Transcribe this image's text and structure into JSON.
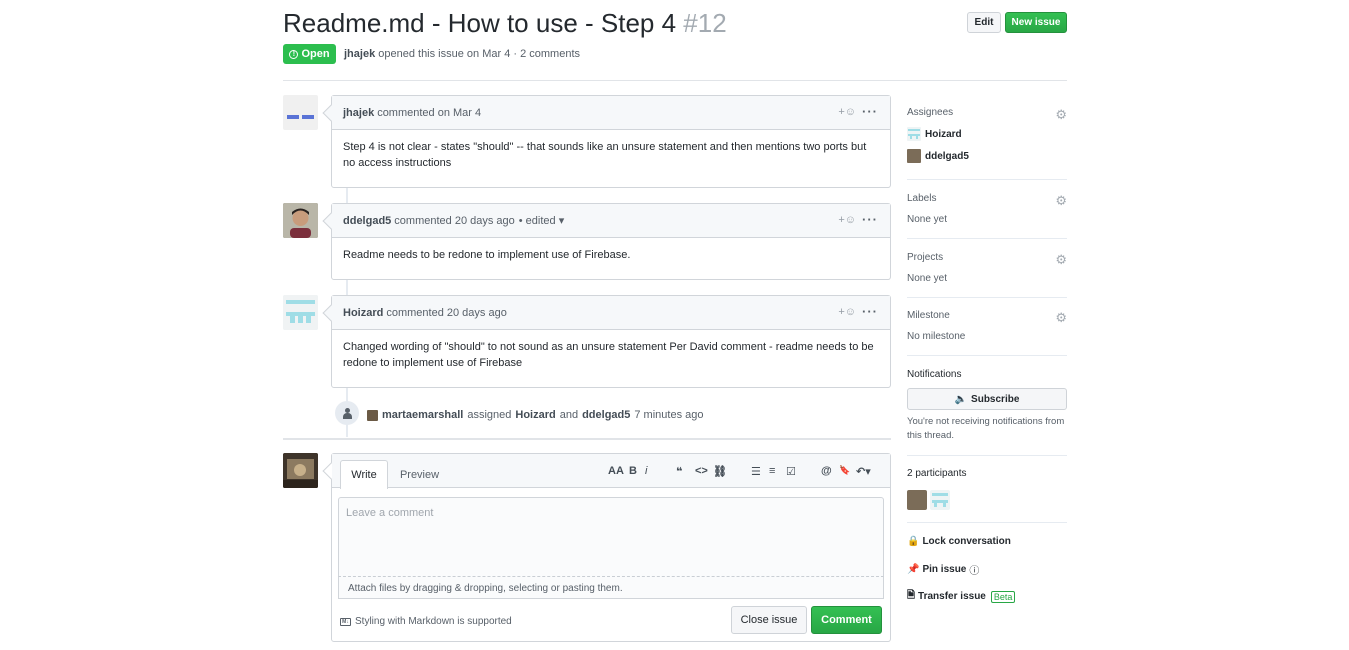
{
  "issue": {
    "title": "Readme.md - How to use - Step 4",
    "number": "#12",
    "state": "Open",
    "author": "jhajek",
    "meta_rest": "opened this issue on Mar 4 · 2 comments"
  },
  "header_buttons": {
    "edit": "Edit",
    "new_issue": "New issue"
  },
  "comments": [
    {
      "author": "jhajek",
      "action": "commented on Mar 4",
      "edited": "",
      "body": "Step 4 is not clear - states \"should\" -- that sounds like an unsure statement and then mentions two ports but no access instructions"
    },
    {
      "author": "ddelgad5",
      "action": "commented 20 days ago",
      "edited": "• edited ▾",
      "body": "Readme needs to be redone to implement use of Firebase."
    },
    {
      "author": "Hoizard",
      "action": "commented 20 days ago",
      "edited": "",
      "body": "Changed wording of \"should\" to not sound as an unsure statement Per David comment - readme needs to be redone to implement use of Firebase"
    }
  ],
  "comment_actions": {
    "react": "+☺",
    "menu": "···"
  },
  "event": {
    "actor": "martaemarshall",
    "verb": "assigned",
    "user1": "Hoizard",
    "conj": "and",
    "user2": "ddelgad5",
    "time": "7 minutes ago"
  },
  "new_comment": {
    "tab_write": "Write",
    "tab_preview": "Preview",
    "placeholder": "Leave a comment",
    "attach_text": "Attach files by dragging & dropping, selecting or pasting them.",
    "markdown_note": "Styling with Markdown is supported",
    "close_button": "Close issue",
    "comment_button": "Comment",
    "toolbar": {
      "header": "AA",
      "bold": "B",
      "italic": "i",
      "quote": "❝",
      "code": "<>",
      "link": "⛓",
      "bullet_list": "☰",
      "numbered_list": "≡",
      "task_list": "☑",
      "mention": "@",
      "bookmark": "🔖",
      "reply": "↶▾"
    }
  },
  "sidebar": {
    "assignees_title": "Assignees",
    "assignees": [
      "Hoizard",
      "ddelgad5"
    ],
    "labels_title": "Labels",
    "labels_value": "None yet",
    "projects_title": "Projects",
    "projects_value": "None yet",
    "milestone_title": "Milestone",
    "milestone_value": "No milestone",
    "notifications_title": "Notifications",
    "subscribe": "Subscribe",
    "notify_note": "You're not receiving notifications from this thread.",
    "participants_title": "2 participants",
    "lock": "Lock conversation",
    "pin": "Pin issue",
    "transfer": "Transfer issue",
    "beta": "Beta"
  },
  "colors": {
    "green": "#28a745",
    "open_badge": "#2cbe4e",
    "border": "#d1d5da"
  },
  "icons": [
    "gear-icon",
    "lock-icon",
    "pin-icon",
    "transfer-icon",
    "speaker-icon",
    "markdown-icon",
    "person-icon",
    "info-icon"
  ]
}
